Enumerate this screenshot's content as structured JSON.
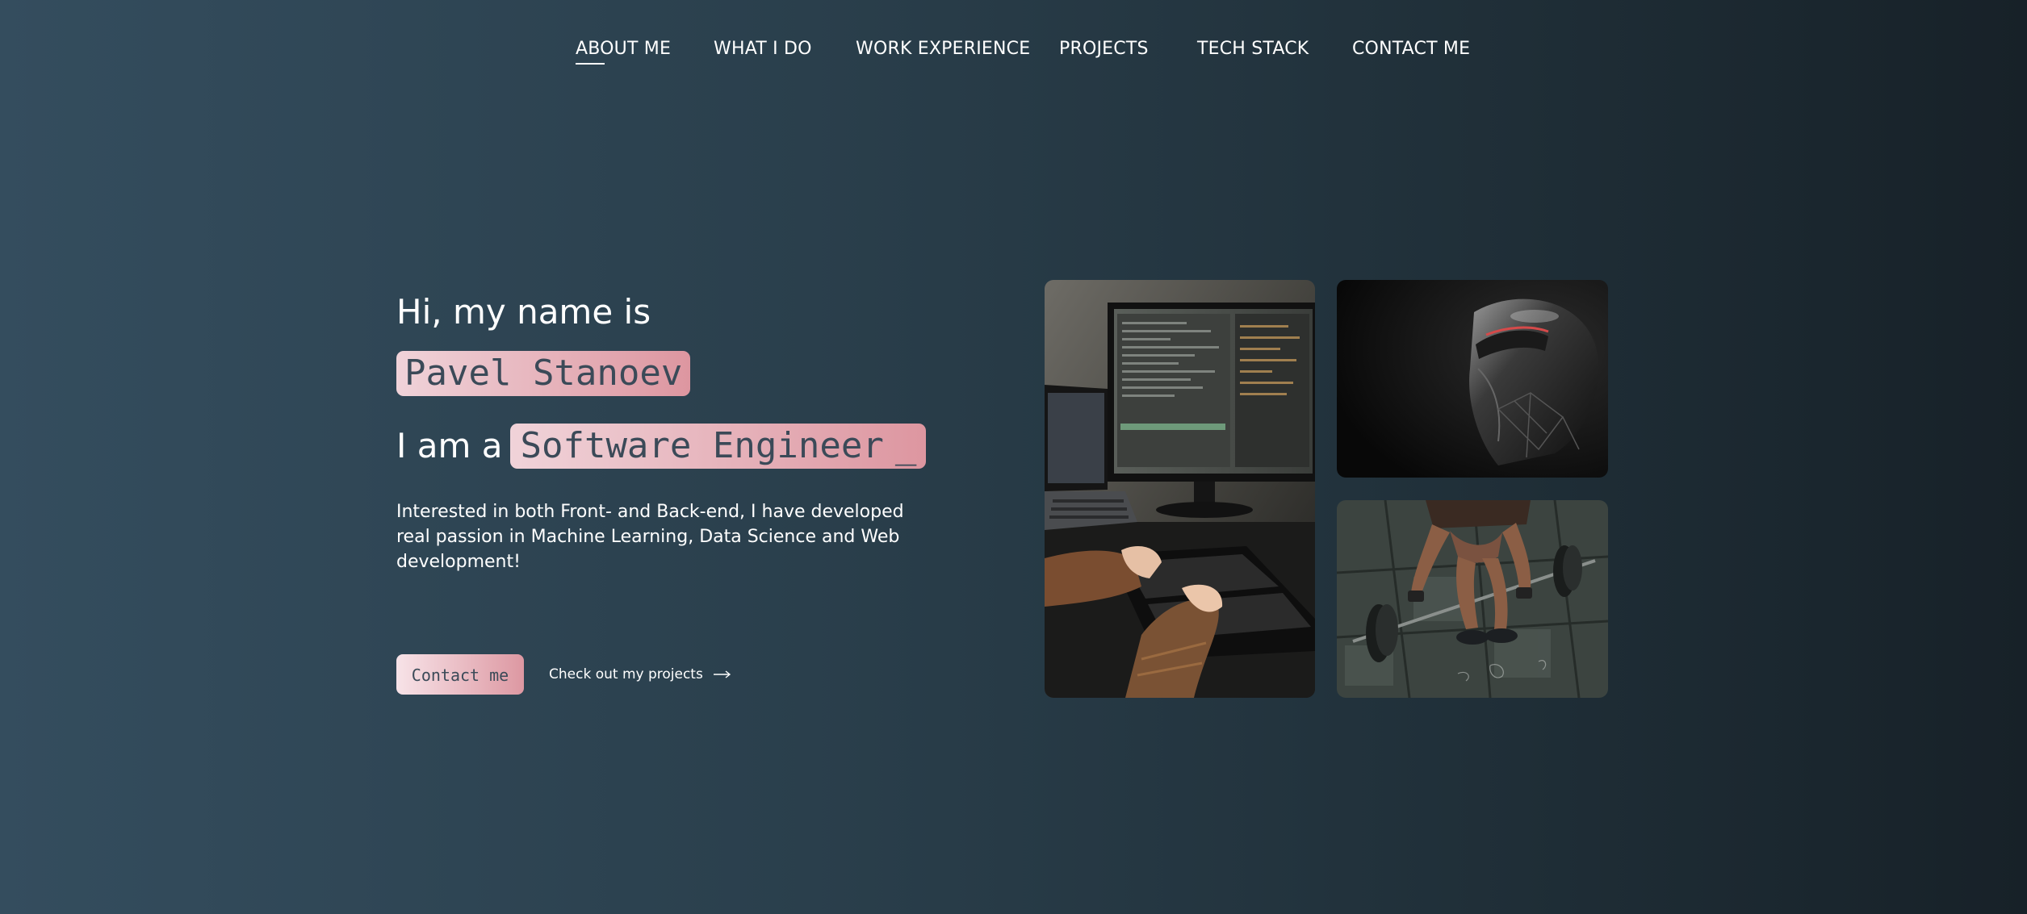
{
  "nav": {
    "items": [
      {
        "label": "ABOUT ME",
        "active": true
      },
      {
        "label": "WHAT I DO",
        "active": false
      },
      {
        "label": "WORK EXPERIENCE",
        "active": false
      },
      {
        "label": "PROJECTS",
        "active": false
      },
      {
        "label": "TECH STACK",
        "active": false
      },
      {
        "label": "CONTACT ME",
        "active": false
      }
    ]
  },
  "hero": {
    "greeting": "Hi, my name is",
    "name": "Pavel Stanoev",
    "iam": "I am a",
    "role": "Software Engineer",
    "cursor": "_",
    "intro": "Interested in both Front- and Back-end, I have developed real passion in Machine Learning, Data Science and Web development!",
    "contact_button": "Contact me",
    "projects_link": "Check out my projects"
  },
  "images": {
    "desk": "computer-desk-photo",
    "robot": "robot-helmet-photo",
    "gym": "weightlifting-photo"
  },
  "colors": {
    "bg_left": "#344d5e",
    "bg_right": "#172128",
    "chip_light": "#f0d3d9",
    "chip_dark": "#dd96a0",
    "chip_text": "#3b4a58"
  }
}
